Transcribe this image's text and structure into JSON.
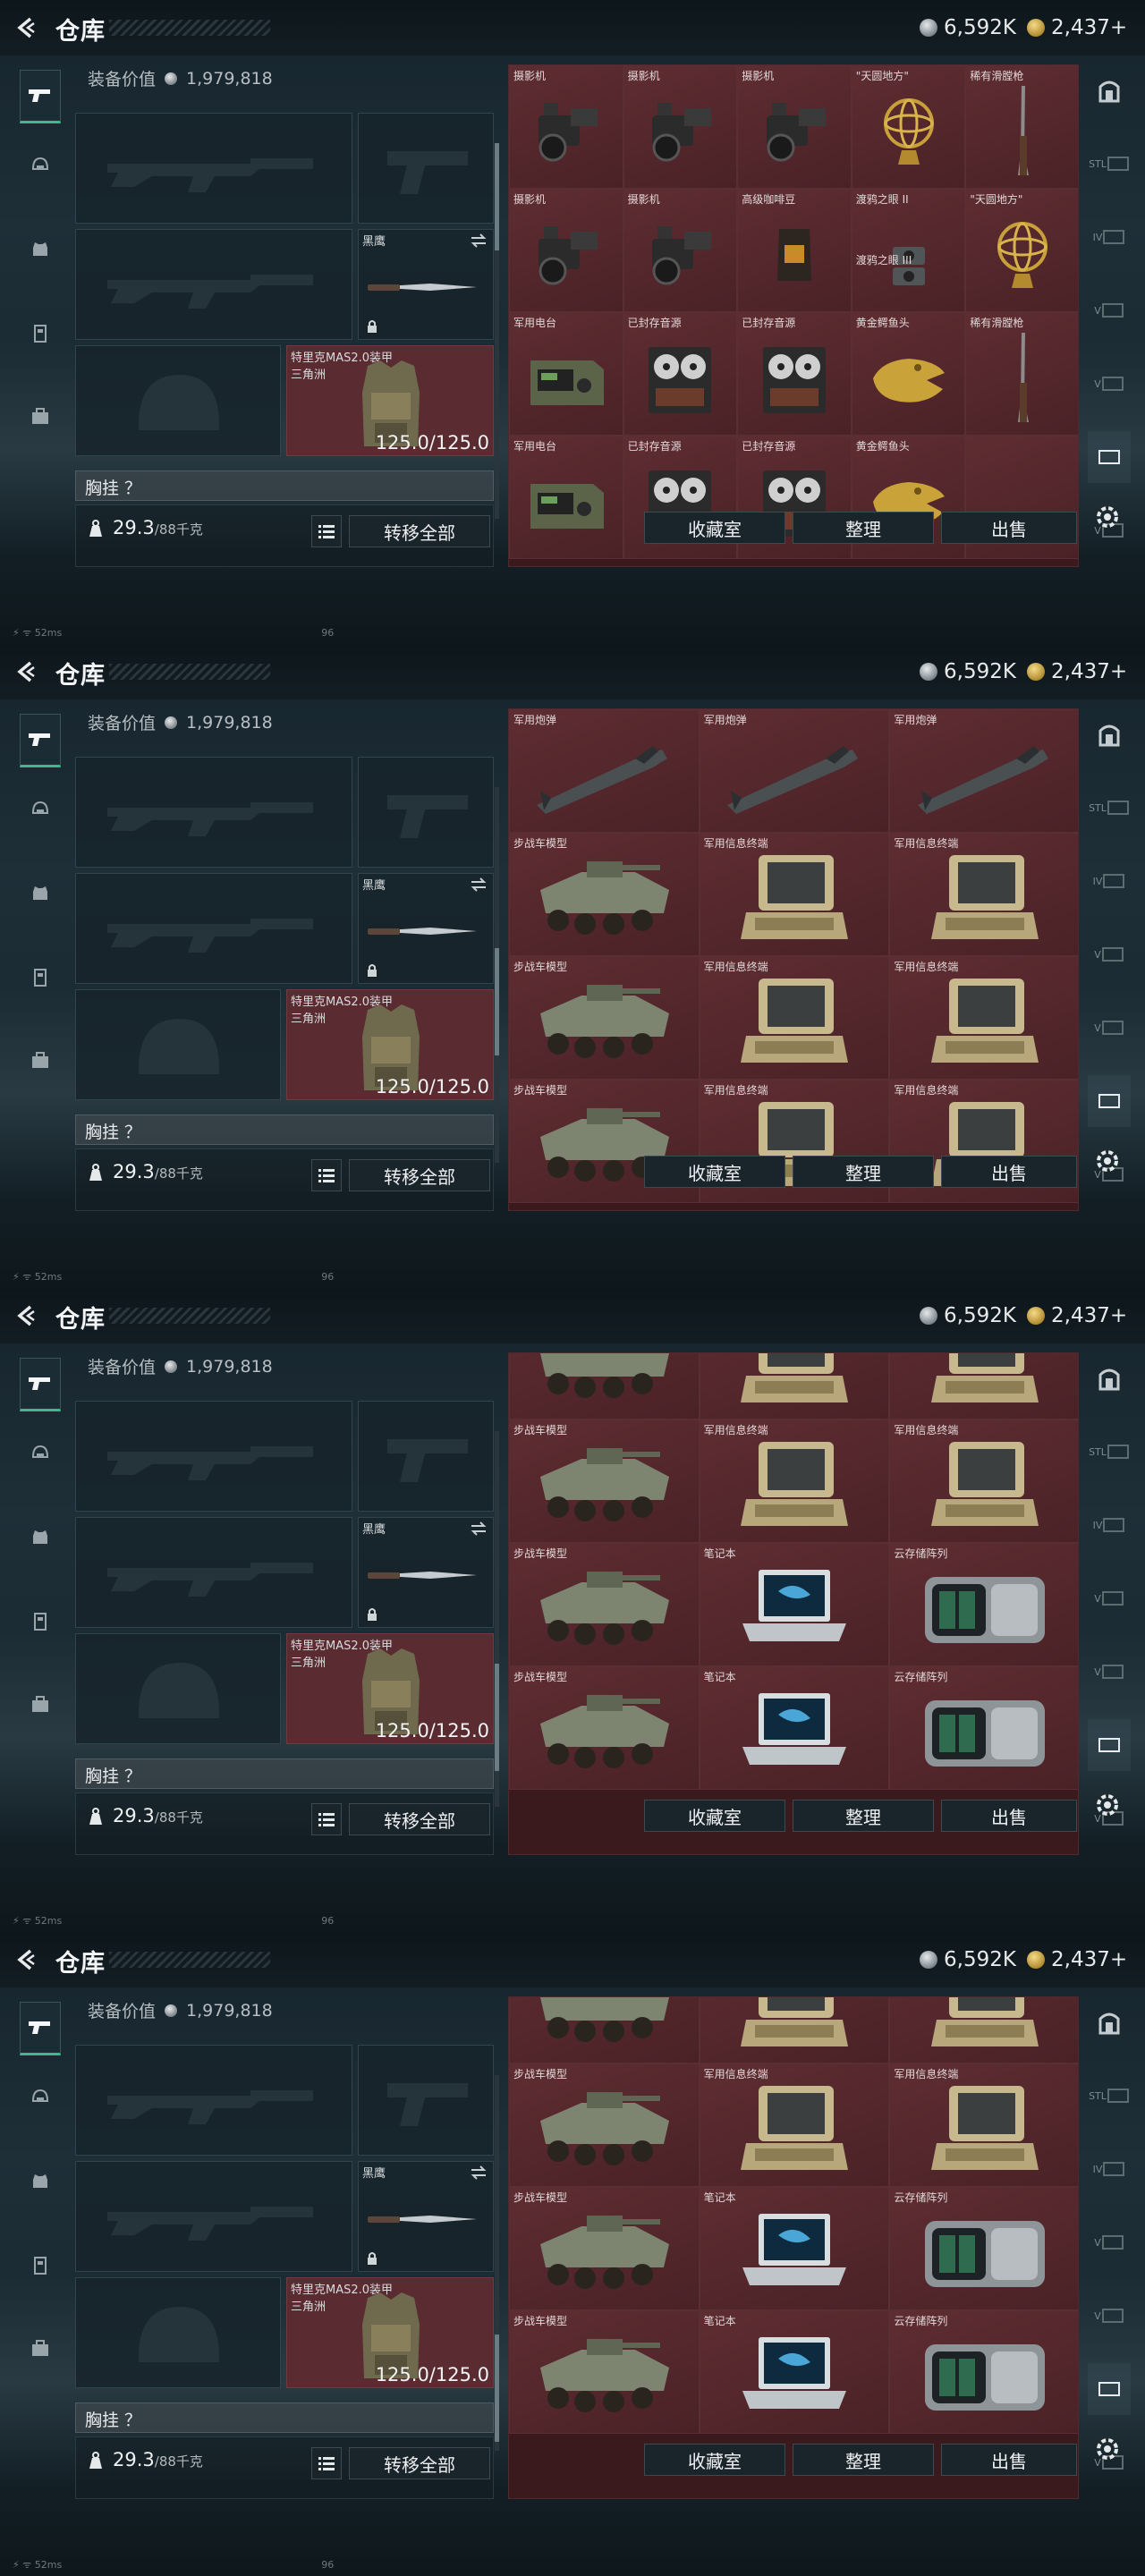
{
  "header": {
    "title": "仓库",
    "silver": "6,592K",
    "gold": "2,437+"
  },
  "equipment": {
    "value_label": "装备价值",
    "value": "1,979,818",
    "knife_label": "黑鹰",
    "armor_label_line1": "特里克MAS2.0装甲",
    "armor_label_line2": "三角洲",
    "armor_durability": "125.0/125.0",
    "chest_label": "胸挂 ？",
    "weight": "29.3",
    "weight_unit": "/88千克",
    "transfer_all": "转移全部"
  },
  "actions": {
    "collection": "收藏室",
    "sort": "整理",
    "sell": "出售"
  },
  "status": {
    "ping": "52ms",
    "fps": "96"
  },
  "rightnav": [
    "",
    "STL",
    "IV",
    "V",
    "V",
    "",
    "V"
  ],
  "frames": [
    {
      "grid": [
        [
          "摄影机",
          "摄影机",
          "摄影机",
          "\"天圆地方\"",
          "稀有滑膛枪"
        ],
        [
          "摄影机",
          "摄影机",
          "高级咖啡豆",
          "渡鸦之眼 II",
          "\"天圆地方\""
        ],
        [
          "军用电台",
          "已封存音源",
          "已封存音源",
          "黄金鳄鱼头",
          "稀有滑膛枪"
        ],
        [
          "军用电台",
          "已封存音源",
          "已封存音源",
          "黄金鳄鱼头",
          ""
        ]
      ]
    },
    {
      "grid": [
        [
          "军用炮弹",
          "军用炮弹",
          "军用炮弹"
        ],
        [
          "步战车模型",
          "军用信息终端",
          "军用信息终端"
        ],
        [
          "步战车模型",
          "军用信息终端",
          "军用信息终端"
        ],
        [
          "步战车模型",
          "军用信息终端",
          "军用信息终端"
        ]
      ]
    },
    {
      "grid": [
        [
          "",
          "",
          ""
        ],
        [
          "步战车模型",
          "军用信息终端",
          "军用信息终端"
        ],
        [
          "步战车模型",
          "笔记本",
          "云存储阵列"
        ],
        [
          "步战车模型",
          "笔记本",
          "云存储阵列"
        ]
      ]
    },
    {
      "grid": [
        [
          "",
          "",
          ""
        ],
        [
          "步战车模型",
          "军用信息终端",
          "军用信息终端"
        ],
        [
          "步战车模型",
          "笔记本",
          "云存储阵列"
        ],
        [
          "步战车模型",
          "笔记本",
          "云存储阵列"
        ]
      ]
    }
  ],
  "extra_labels": {
    "raven_eye_iii": "渡鸦之眼 III"
  }
}
